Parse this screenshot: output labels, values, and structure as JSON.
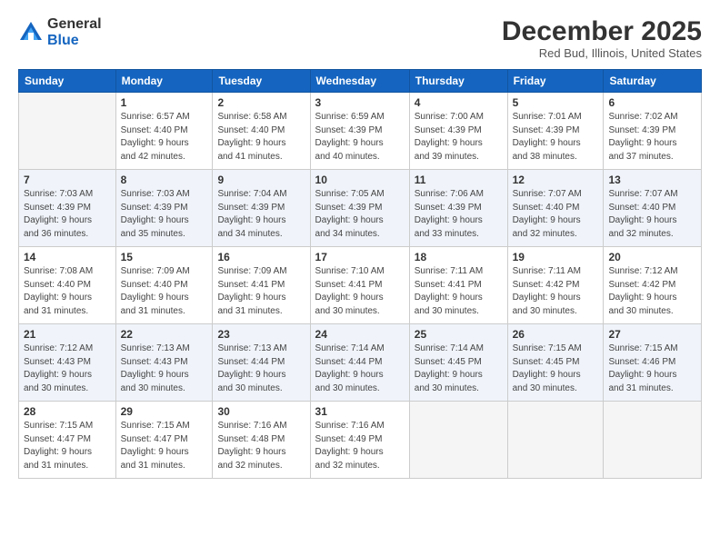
{
  "logo": {
    "general": "General",
    "blue": "Blue"
  },
  "header": {
    "month": "December 2025",
    "location": "Red Bud, Illinois, United States"
  },
  "weekdays": [
    "Sunday",
    "Monday",
    "Tuesday",
    "Wednesday",
    "Thursday",
    "Friday",
    "Saturday"
  ],
  "weeks": [
    [
      {
        "day": "",
        "info": ""
      },
      {
        "day": "1",
        "info": "Sunrise: 6:57 AM\nSunset: 4:40 PM\nDaylight: 9 hours\nand 42 minutes."
      },
      {
        "day": "2",
        "info": "Sunrise: 6:58 AM\nSunset: 4:40 PM\nDaylight: 9 hours\nand 41 minutes."
      },
      {
        "day": "3",
        "info": "Sunrise: 6:59 AM\nSunset: 4:39 PM\nDaylight: 9 hours\nand 40 minutes."
      },
      {
        "day": "4",
        "info": "Sunrise: 7:00 AM\nSunset: 4:39 PM\nDaylight: 9 hours\nand 39 minutes."
      },
      {
        "day": "5",
        "info": "Sunrise: 7:01 AM\nSunset: 4:39 PM\nDaylight: 9 hours\nand 38 minutes."
      },
      {
        "day": "6",
        "info": "Sunrise: 7:02 AM\nSunset: 4:39 PM\nDaylight: 9 hours\nand 37 minutes."
      }
    ],
    [
      {
        "day": "7",
        "info": "Sunrise: 7:03 AM\nSunset: 4:39 PM\nDaylight: 9 hours\nand 36 minutes."
      },
      {
        "day": "8",
        "info": "Sunrise: 7:03 AM\nSunset: 4:39 PM\nDaylight: 9 hours\nand 35 minutes."
      },
      {
        "day": "9",
        "info": "Sunrise: 7:04 AM\nSunset: 4:39 PM\nDaylight: 9 hours\nand 34 minutes."
      },
      {
        "day": "10",
        "info": "Sunrise: 7:05 AM\nSunset: 4:39 PM\nDaylight: 9 hours\nand 34 minutes."
      },
      {
        "day": "11",
        "info": "Sunrise: 7:06 AM\nSunset: 4:39 PM\nDaylight: 9 hours\nand 33 minutes."
      },
      {
        "day": "12",
        "info": "Sunrise: 7:07 AM\nSunset: 4:40 PM\nDaylight: 9 hours\nand 32 minutes."
      },
      {
        "day": "13",
        "info": "Sunrise: 7:07 AM\nSunset: 4:40 PM\nDaylight: 9 hours\nand 32 minutes."
      }
    ],
    [
      {
        "day": "14",
        "info": "Sunrise: 7:08 AM\nSunset: 4:40 PM\nDaylight: 9 hours\nand 31 minutes."
      },
      {
        "day": "15",
        "info": "Sunrise: 7:09 AM\nSunset: 4:40 PM\nDaylight: 9 hours\nand 31 minutes."
      },
      {
        "day": "16",
        "info": "Sunrise: 7:09 AM\nSunset: 4:41 PM\nDaylight: 9 hours\nand 31 minutes."
      },
      {
        "day": "17",
        "info": "Sunrise: 7:10 AM\nSunset: 4:41 PM\nDaylight: 9 hours\nand 30 minutes."
      },
      {
        "day": "18",
        "info": "Sunrise: 7:11 AM\nSunset: 4:41 PM\nDaylight: 9 hours\nand 30 minutes."
      },
      {
        "day": "19",
        "info": "Sunrise: 7:11 AM\nSunset: 4:42 PM\nDaylight: 9 hours\nand 30 minutes."
      },
      {
        "day": "20",
        "info": "Sunrise: 7:12 AM\nSunset: 4:42 PM\nDaylight: 9 hours\nand 30 minutes."
      }
    ],
    [
      {
        "day": "21",
        "info": "Sunrise: 7:12 AM\nSunset: 4:43 PM\nDaylight: 9 hours\nand 30 minutes."
      },
      {
        "day": "22",
        "info": "Sunrise: 7:13 AM\nSunset: 4:43 PM\nDaylight: 9 hours\nand 30 minutes."
      },
      {
        "day": "23",
        "info": "Sunrise: 7:13 AM\nSunset: 4:44 PM\nDaylight: 9 hours\nand 30 minutes."
      },
      {
        "day": "24",
        "info": "Sunrise: 7:14 AM\nSunset: 4:44 PM\nDaylight: 9 hours\nand 30 minutes."
      },
      {
        "day": "25",
        "info": "Sunrise: 7:14 AM\nSunset: 4:45 PM\nDaylight: 9 hours\nand 30 minutes."
      },
      {
        "day": "26",
        "info": "Sunrise: 7:15 AM\nSunset: 4:45 PM\nDaylight: 9 hours\nand 30 minutes."
      },
      {
        "day": "27",
        "info": "Sunrise: 7:15 AM\nSunset: 4:46 PM\nDaylight: 9 hours\nand 31 minutes."
      }
    ],
    [
      {
        "day": "28",
        "info": "Sunrise: 7:15 AM\nSunset: 4:47 PM\nDaylight: 9 hours\nand 31 minutes."
      },
      {
        "day": "29",
        "info": "Sunrise: 7:15 AM\nSunset: 4:47 PM\nDaylight: 9 hours\nand 31 minutes."
      },
      {
        "day": "30",
        "info": "Sunrise: 7:16 AM\nSunset: 4:48 PM\nDaylight: 9 hours\nand 32 minutes."
      },
      {
        "day": "31",
        "info": "Sunrise: 7:16 AM\nSunset: 4:49 PM\nDaylight: 9 hours\nand 32 minutes."
      },
      {
        "day": "",
        "info": ""
      },
      {
        "day": "",
        "info": ""
      },
      {
        "day": "",
        "info": ""
      }
    ]
  ]
}
